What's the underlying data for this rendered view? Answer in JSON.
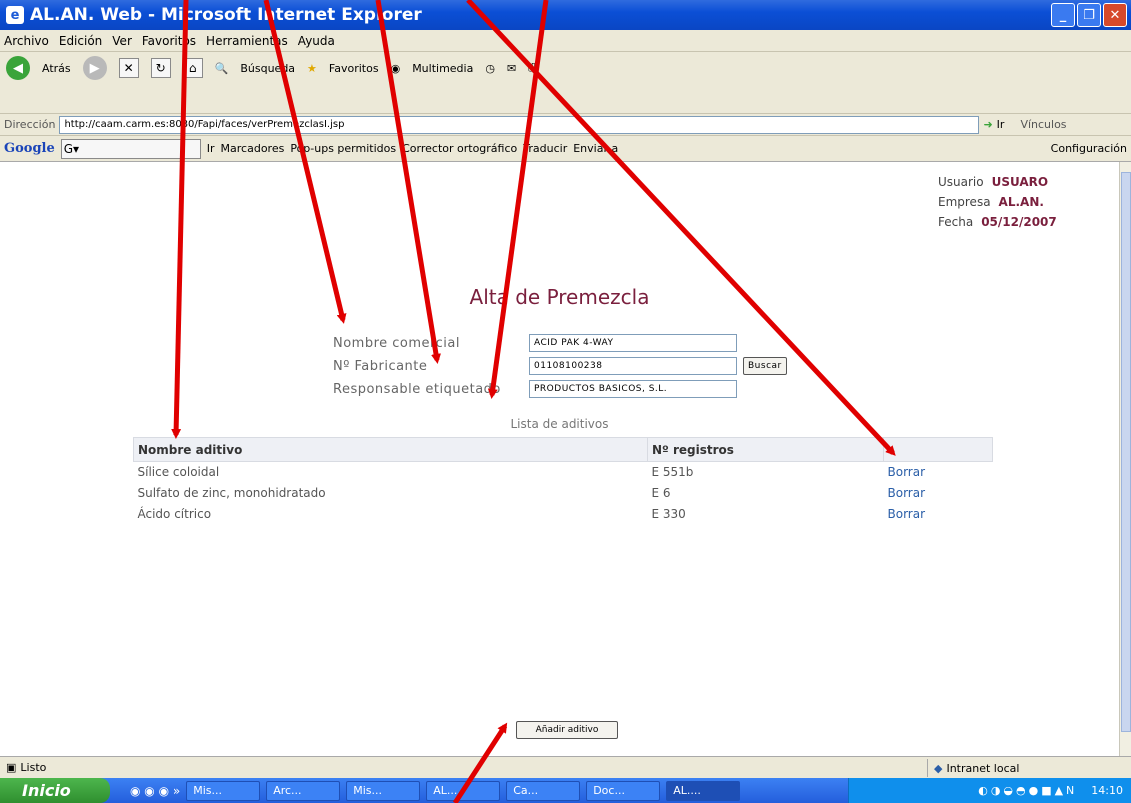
{
  "window": {
    "title": "AL.AN. Web - Microsoft Internet Explorer"
  },
  "menu": [
    "Archivo",
    "Edición",
    "Ver",
    "Favoritos",
    "Herramientas",
    "Ayuda"
  ],
  "toolbar": {
    "back": "Atrás",
    "search": "Búsqueda",
    "favorites": "Favoritos",
    "multimedia": "Multimedia"
  },
  "address": {
    "label": "Dirección",
    "url": "http://caam.carm.es:8080/Fapi/faces/verPremezclasI.jsp",
    "go": "Ir",
    "links": "Vínculos"
  },
  "google": {
    "logo": "Google",
    "go": "Ir",
    "bookmarks": "Marcadores",
    "popups": "Pop-ups permitidos",
    "spell": "Corrector ortográfico",
    "translate": "Traducir",
    "send": "Enviar a",
    "settings": "Configuración"
  },
  "user": {
    "usuario_label": "Usuario",
    "usuario": "USUARO",
    "empresa_label": "Empresa",
    "empresa": "AL.AN.",
    "fecha_label": "Fecha",
    "fecha": "05/12/2007"
  },
  "page": {
    "title": "Alta de Premezcla",
    "list_title": "Lista de aditivos",
    "add_button": "Añadir aditivo"
  },
  "form": {
    "nombre_label": "Nombre comercial",
    "nombre": "ACID PAK 4-WAY",
    "fabricante_label": "Nº Fabricante",
    "fabricante": "01108100238",
    "buscar": "Buscar",
    "responsable_label": "Responsable etiquetado",
    "responsable": "PRODUCTOS BASICOS, S.L."
  },
  "table": {
    "headers": [
      "Nombre aditivo",
      "Nº registros",
      ""
    ],
    "rows": [
      {
        "name": "Sílice coloidal",
        "reg": "E 551b",
        "action": "Borrar"
      },
      {
        "name": "Sulfato de zinc, monohidratado",
        "reg": "E 6",
        "action": "Borrar"
      },
      {
        "name": "Ácido cítrico",
        "reg": "E 330",
        "action": "Borrar"
      }
    ]
  },
  "status": {
    "text": "Listo",
    "zone": "Intranet local"
  },
  "taskbar": {
    "start": "Inicio",
    "tasks": [
      "Mis...",
      "Arc...",
      "Mis...",
      "AL....",
      "Ca...",
      "Doc...",
      "AL...."
    ],
    "clock": "14:10"
  },
  "colors": {
    "accent": "#7a1f3d",
    "link": "#2b5fa8",
    "arrow": "#e00000"
  }
}
